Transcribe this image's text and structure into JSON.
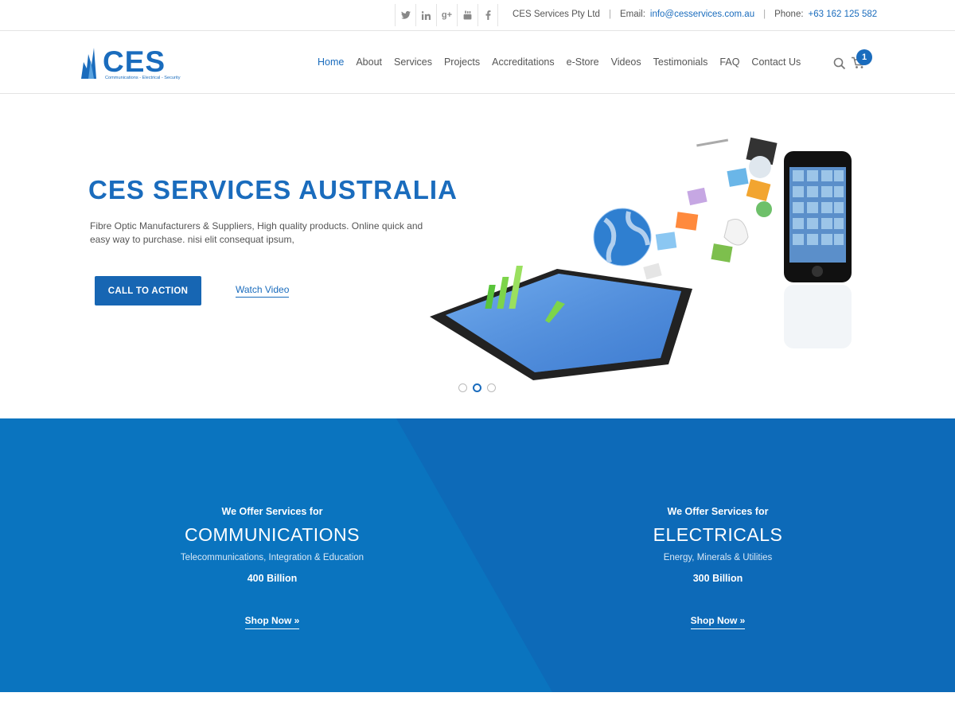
{
  "topbar": {
    "social_icons": [
      "twitter-icon",
      "linkedin-icon",
      "google-plus-icon",
      "youtube-icon",
      "facebook-icon"
    ],
    "company": "CES Services Pty Ltd",
    "email_label": "Email:",
    "email": "info@cesservices.com.au",
    "phone_label": "Phone:",
    "phone": "+63 162 125 582"
  },
  "header": {
    "logo_text": "CES",
    "logo_tagline": "Communications - Electrical - Security",
    "nav": [
      "Home",
      "About",
      "Services",
      "Projects",
      "Accreditations",
      "e-Store",
      "Videos",
      "Testimonials",
      "FAQ",
      "Contact Us"
    ],
    "active_nav": "Home",
    "cart_count": "1"
  },
  "hero": {
    "title": "CES SERVICES AUSTRALIA",
    "description": "Fibre Optic Manufacturers & Suppliers, High quality products. Online quick and easy way to purchase. nisi elit consequat ipsum,",
    "cta_label": "CALL TO ACTION",
    "watch_label": "Watch Video",
    "slides": 3,
    "active_slide": 2
  },
  "services": [
    {
      "pre": "We Offer Services for",
      "name": "COMMUNICATIONS",
      "sub": "Telecommunications, Integration & Education",
      "amount": "400 Billion",
      "shop": "Shop Now »"
    },
    {
      "pre": "We Offer Services for",
      "name": "ELECTRICALS",
      "sub": "Energy, Minerals & Utilities",
      "amount": "300 Billion",
      "shop": "Shop Now »"
    }
  ],
  "colors": {
    "brand_blue": "#1a6cbd",
    "band_left": "#0a74bf",
    "band_right": "#0d6ab8"
  }
}
